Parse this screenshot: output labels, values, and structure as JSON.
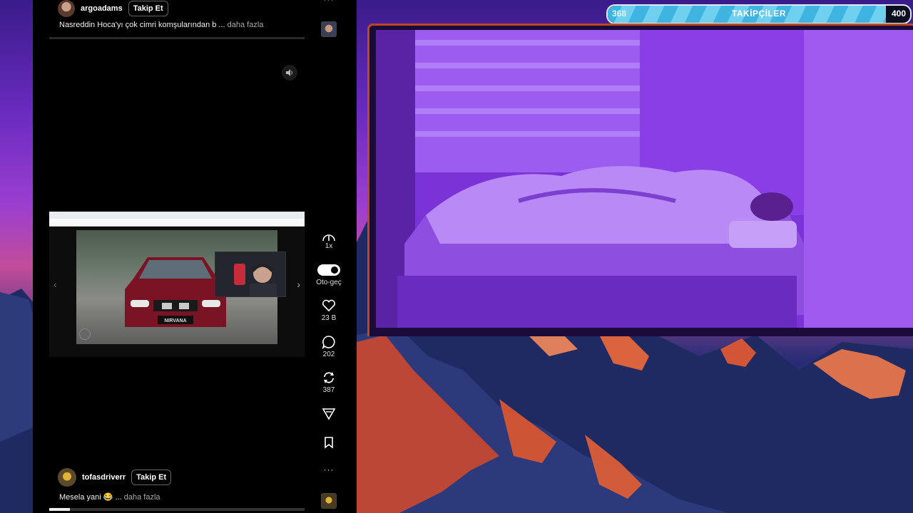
{
  "feed": {
    "top_post": {
      "username": "argoadams",
      "follow_label": "Takip Et",
      "caption": "Nasreddin Hoca'yı çok cimri komşularından b ...",
      "more_label": "daha fazla"
    },
    "video_post": {
      "username": "tofasdriverr",
      "follow_label": "Takip Et",
      "caption": "Mesela yani 😂 ...",
      "more_label": "daha fazla",
      "plate_text": "NIRVANA",
      "progress": 0.08
    }
  },
  "rail": {
    "top_more_label": "···",
    "speed_label": "1x",
    "autoplay_label": "Oto-geç",
    "likes": "23 B",
    "comments": "202",
    "reposts": "387",
    "bottom_more_label": "···"
  },
  "followers_bar": {
    "title": "TAKİPÇİLER",
    "current": "368",
    "goal": "400",
    "fill_fraction": 0.92
  }
}
